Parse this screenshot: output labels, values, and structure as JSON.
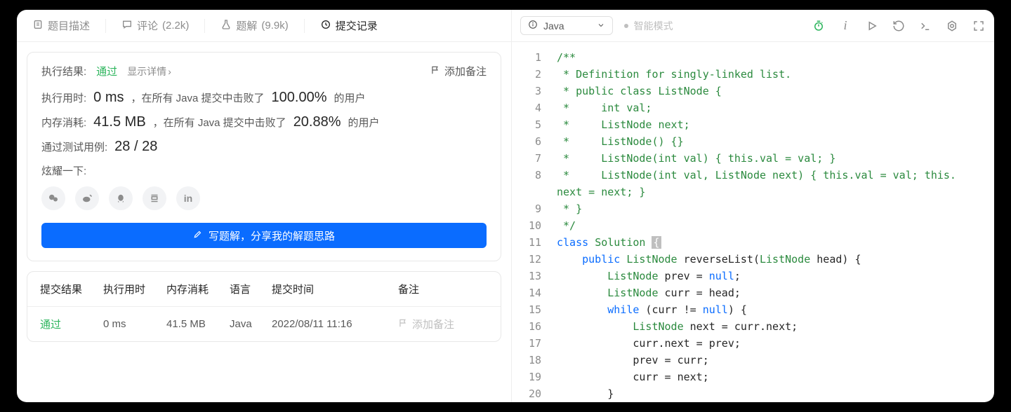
{
  "tabs": {
    "description": "题目描述",
    "comments_label": "评论",
    "comments_count": "(2.2k)",
    "solutions_label": "题解",
    "solutions_count": "(9.9k)",
    "submissions": "提交记录"
  },
  "result": {
    "exec_result_label": "执行结果:",
    "status": "通过",
    "show_details": "显示详情",
    "add_note": "添加备注",
    "runtime_label": "执行用时:",
    "runtime_value": "0 ms",
    "runtime_mid": "，在所有 Java 提交中击败了",
    "runtime_pct": "100.00%",
    "runtime_suffix": "的用户",
    "memory_label": "内存消耗:",
    "memory_value": "41.5 MB",
    "memory_mid": "，在所有 Java 提交中击败了",
    "memory_pct": "20.88%",
    "memory_suffix": "的用户",
    "testcases_label": "通过测试用例:",
    "testcases_value": "28 / 28",
    "share_label": "炫耀一下:",
    "write_solution_btn": "写题解，分享我的解题思路"
  },
  "table": {
    "headers": {
      "result": "提交结果",
      "runtime": "执行用时",
      "memory": "内存消耗",
      "language": "语言",
      "time": "提交时间",
      "note": "备注"
    },
    "row": {
      "result": "通过",
      "runtime": "0 ms",
      "memory": "41.5 MB",
      "language": "Java",
      "time": "2022/08/11 11:16",
      "note": "添加备注"
    }
  },
  "toolbar": {
    "language": "Java",
    "smart_mode": "智能模式"
  },
  "code": {
    "lines": [
      {
        "n": "1",
        "html": "<span class='c-comment'>/**</span>"
      },
      {
        "n": "2",
        "html": "<span class='c-comment'> * Definition for singly-linked list.</span>"
      },
      {
        "n": "3",
        "html": "<span class='c-comment'> * public class ListNode {</span>"
      },
      {
        "n": "4",
        "html": "<span class='c-comment'> *     int val;</span>"
      },
      {
        "n": "5",
        "html": "<span class='c-comment'> *     ListNode next;</span>"
      },
      {
        "n": "6",
        "html": "<span class='c-comment'> *     ListNode() {}</span>"
      },
      {
        "n": "7",
        "html": "<span class='c-comment'> *     ListNode(int val) { this.val = val; }</span>"
      },
      {
        "n": "8",
        "html": "<span class='c-comment'> *     ListNode(int val, ListNode next) { this.val = val; this.\nnext = next; }</span>"
      },
      {
        "n": "9",
        "html": "<span class='c-comment'> * }</span>"
      },
      {
        "n": "10",
        "html": "<span class='c-comment'> */</span>"
      },
      {
        "n": "11",
        "html": "<span class='c-keyword'>class</span> <span class='c-type'>Solution</span> <span class='c-cursor'>{</span>"
      },
      {
        "n": "12",
        "html": "    <span class='c-keyword'>public</span> <span class='c-type'>ListNode</span> reverseList(<span class='c-type'>ListNode</span> head) {"
      },
      {
        "n": "13",
        "html": "        <span class='c-type'>ListNode</span> prev = <span class='c-keyword'>null</span>;"
      },
      {
        "n": "14",
        "html": "        <span class='c-type'>ListNode</span> curr = head;"
      },
      {
        "n": "15",
        "html": "        <span class='c-keyword'>while</span> (curr != <span class='c-keyword'>null</span>) {"
      },
      {
        "n": "16",
        "html": "            <span class='c-type'>ListNode</span> next = curr.next;"
      },
      {
        "n": "17",
        "html": "            curr.next = prev;"
      },
      {
        "n": "18",
        "html": "            prev = curr;"
      },
      {
        "n": "19",
        "html": "            curr = next;"
      },
      {
        "n": "20",
        "html": "        }"
      }
    ]
  }
}
